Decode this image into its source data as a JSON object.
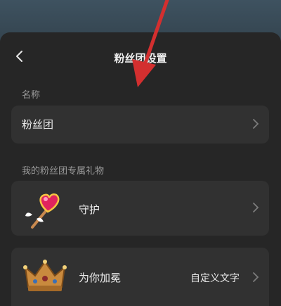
{
  "header": {
    "title": "粉丝团设置",
    "back_icon": "chevron-left-icon"
  },
  "name_section": {
    "label": "名称",
    "value": "粉丝团"
  },
  "gifts_section": {
    "label": "我的粉丝团专属礼物",
    "items": [
      {
        "name": "守护",
        "icon": "heart-wand-icon",
        "value": ""
      },
      {
        "name": "为你加冕",
        "icon": "crown-icon",
        "value": "自定义文字"
      }
    ]
  },
  "colors": {
    "sheet_bg": "#262626",
    "row_bg": "#313131",
    "arrow": "#d32f2f"
  }
}
